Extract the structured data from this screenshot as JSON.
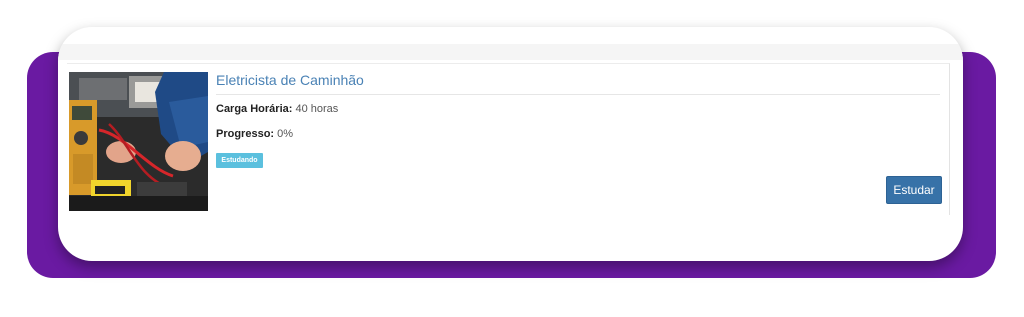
{
  "course": {
    "title": "Eletricista de Caminhão",
    "workload_label": "Carga Horária:",
    "workload_value": "40 horas",
    "progress_label": "Progresso:",
    "progress_value": "0%",
    "status_badge": "Estudando",
    "action_button": "Estudar",
    "thumbnail_alt": "Eletricista de Caminhão"
  },
  "colors": {
    "backdrop": "#6a1aa2",
    "title_link": "#4a82b5",
    "badge": "#5bc0de",
    "button": "#3772a8"
  }
}
